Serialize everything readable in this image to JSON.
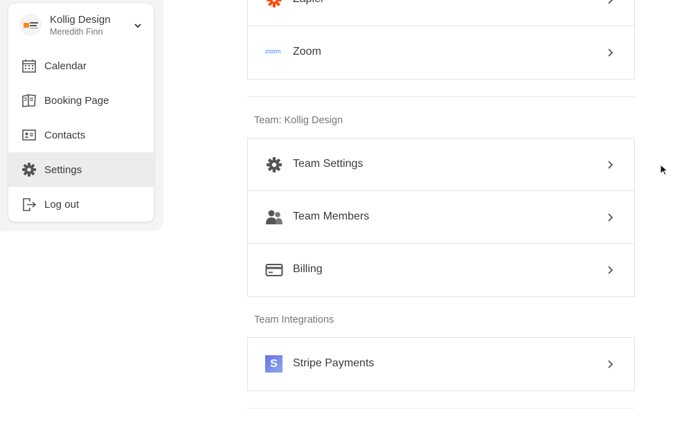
{
  "account": {
    "name": "Kollig Design",
    "user": "Meredith Finn"
  },
  "menu": {
    "items": [
      {
        "label": "Calendar",
        "icon": "calendar-icon"
      },
      {
        "label": "Booking Page",
        "icon": "book-icon"
      },
      {
        "label": "Contacts",
        "icon": "contact-card-icon"
      },
      {
        "label": "Settings",
        "icon": "gear-icon",
        "active": true
      },
      {
        "label": "Log out",
        "icon": "logout-icon"
      }
    ]
  },
  "integrations": {
    "items": [
      {
        "label": "Zapier",
        "icon": "zapier-icon"
      },
      {
        "label": "Zoom",
        "icon": "zoom-icon",
        "logo_text": "zoom"
      }
    ]
  },
  "team": {
    "title": "Team: Kollig Design",
    "items": [
      {
        "label": "Team Settings",
        "icon": "gear-icon"
      },
      {
        "label": "Team Members",
        "icon": "people-icon"
      },
      {
        "label": "Billing",
        "icon": "credit-card-icon"
      }
    ]
  },
  "team_integrations": {
    "title": "Team Integrations",
    "items": [
      {
        "label": "Stripe Payments",
        "icon": "stripe-icon",
        "logo_text": "S"
      }
    ]
  },
  "colors": {
    "zapier": "#ff4a00",
    "stripe_start": "#6772e5",
    "stripe_end": "#8fa5ef",
    "zoom": "#2d8cff"
  }
}
